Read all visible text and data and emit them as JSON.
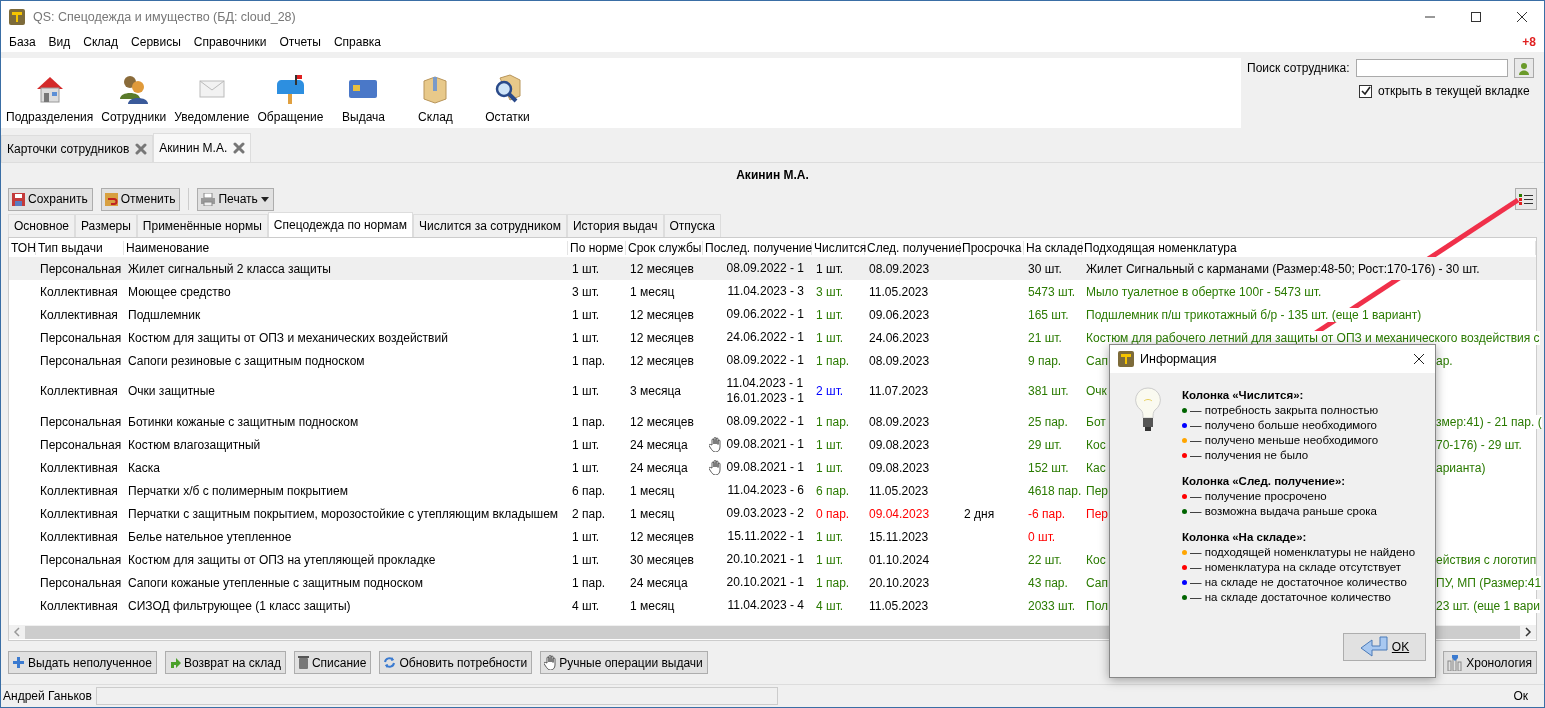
{
  "window": {
    "title": "QS: Спецодежда и имущество (БД: cloud_28)"
  },
  "menu": [
    "База",
    "Вид",
    "Склад",
    "Сервисы",
    "Справочники",
    "Отчеты",
    "Справка"
  ],
  "notification_count": "+8",
  "toolbar": [
    "Подразделения",
    "Сотрудники",
    "Уведомление",
    "Обращение",
    "Выдача",
    "Склад",
    "Остатки"
  ],
  "employee_search": {
    "label": "Поиск сотрудника:",
    "open_in_current_tab": {
      "label": "открыть в текущей вкладке",
      "checked": true
    }
  },
  "document_tabs": [
    {
      "label": "Карточки сотрудников",
      "selected": false
    },
    {
      "label": "Акинин М.А.",
      "selected": true
    }
  ],
  "heading": "Акинин М.А.",
  "actions": [
    {
      "label": "Сохранить",
      "kind": "save"
    },
    {
      "label": "Отменить",
      "kind": "cancel"
    },
    {
      "label": "Печать",
      "kind": "print"
    }
  ],
  "tabs": [
    {
      "label": "Основное",
      "selected": false
    },
    {
      "label": "Размеры",
      "selected": false
    },
    {
      "label": "Применённые нормы",
      "selected": false
    },
    {
      "label": "Спецодежда по нормам",
      "selected": true
    },
    {
      "label": "Числится за сотрудником",
      "selected": false
    },
    {
      "label": "История выдач",
      "selected": false
    },
    {
      "label": "Отпуска",
      "selected": false
    }
  ],
  "table": {
    "columns": [
      "ТОН",
      "Тип выдачи",
      "Наименование",
      "По норме",
      "Срок службы",
      "Послед. получение",
      "Числится",
      "След. получение",
      "Просрочка",
      "На складе",
      "Подходящая номенклатура"
    ],
    "rows": [
      {
        "selected": true,
        "type": "Персональная",
        "name": "Жилет сигнальный 2 класса защиты",
        "norm": "1 шт.",
        "term": "12 месяцев",
        "last": [
          "08.09.2022 - 1"
        ],
        "manual": false,
        "issued": {
          "text": "1 шт.",
          "color": "#000000"
        },
        "next": {
          "text": "08.09.2023",
          "overdue": false
        },
        "stock": {
          "text": "30 шт.",
          "color": "#000000"
        },
        "match": "Жилет Сигнальный с карманами (Размер:48-50; Рост:170-176) - 30 шт."
      },
      {
        "selected": false,
        "type": "Коллективная",
        "name": "Моющее средство",
        "norm": "3 шт.",
        "term": "1 месяц",
        "last": [
          "11.04.2023 - 3"
        ],
        "manual": false,
        "issued": {
          "text": "3 шт.",
          "color": "#2a7a00"
        },
        "next": {
          "text": "11.05.2023",
          "overdue": false
        },
        "stock": {
          "text": "5473 шт.",
          "color": "#2a7a00"
        },
        "match": "Мыло туалетное в обертке 100г - 5473 шт."
      },
      {
        "selected": false,
        "type": "Коллективная",
        "name": "Подшлемник",
        "norm": "1 шт.",
        "term": "12 месяцев",
        "last": [
          "09.06.2022 - 1"
        ],
        "manual": false,
        "issued": {
          "text": "1 шт.",
          "color": "#2a7a00"
        },
        "next": {
          "text": "09.06.2023",
          "overdue": false
        },
        "stock": {
          "text": "165 шт.",
          "color": "#2a7a00"
        },
        "match": "Подшлемник  п/ш трикотажный б/р - 135 шт. (еще 1 вариант)"
      },
      {
        "selected": false,
        "type": "Персональная",
        "name": "Костюм для защиты от ОПЗ и механических воздействий",
        "norm": "1 шт.",
        "term": "12 месяцев",
        "last": [
          "24.06.2022 - 1"
        ],
        "manual": false,
        "issued": {
          "text": "1 шт.",
          "color": "#2a7a00"
        },
        "next": {
          "text": "24.06.2023",
          "overdue": false
        },
        "stock": {
          "text": "21 шт.",
          "color": "#2a7a00"
        },
        "match": "Костюм для рабочего летний для защиты от ОПЗ и механического воздействия с"
      },
      {
        "selected": false,
        "type": "Персональная",
        "name": "Сапоги резиновые с защитным подноском",
        "norm": "1 пар.",
        "term": "12 месяцев",
        "last": [
          "08.09.2022 - 1"
        ],
        "manual": false,
        "issued": {
          "text": "1 пар.",
          "color": "#2a7a00"
        },
        "next": {
          "text": "08.09.2023",
          "overdue": false
        },
        "stock": {
          "text": "9 пар.",
          "color": "#2a7a00"
        },
        "match": "Сап",
        "match_tail": "ар."
      },
      {
        "selected": false,
        "type": "Коллективная",
        "name": "Очки защитные",
        "norm": "1 шт.",
        "term": "3 месяца",
        "last": [
          "11.04.2023 - 1",
          "16.01.2023 - 1"
        ],
        "manual": false,
        "issued": {
          "text": "2 шт.",
          "color": "#0000ff"
        },
        "next": {
          "text": "11.07.2023",
          "overdue": false
        },
        "stock": {
          "text": "381 шт.",
          "color": "#2a7a00"
        },
        "match": "Очк"
      },
      {
        "selected": false,
        "type": "Персональная",
        "name": "Ботинки кожаные с защитным подноском",
        "norm": "1 пар.",
        "term": "12 месяцев",
        "last": [
          "08.09.2022 - 1"
        ],
        "manual": false,
        "issued": {
          "text": "1 пар.",
          "color": "#2a7a00"
        },
        "next": {
          "text": "08.09.2023",
          "overdue": false
        },
        "stock": {
          "text": "25 пар.",
          "color": "#2a7a00"
        },
        "match": "Бот",
        "match_tail": "змер:41) - 21 пар. ("
      },
      {
        "selected": false,
        "type": "Персональная",
        "name": "Костюм влагозащитный",
        "norm": "1 шт.",
        "term": "24 месяца",
        "last": [
          "09.08.2021 - 1"
        ],
        "manual": true,
        "issued": {
          "text": "1 шт.",
          "color": "#2a7a00"
        },
        "next": {
          "text": "09.08.2023",
          "overdue": false
        },
        "stock": {
          "text": "29 шт.",
          "color": "#2a7a00"
        },
        "match": "Кос",
        "match_tail": "70-176) - 29 шт."
      },
      {
        "selected": false,
        "type": "Коллективная",
        "name": "Каска",
        "norm": "1 шт.",
        "term": "24 месяца",
        "last": [
          "09.08.2021 - 1"
        ],
        "manual": true,
        "issued": {
          "text": "1 шт.",
          "color": "#2a7a00"
        },
        "next": {
          "text": "09.08.2023",
          "overdue": false
        },
        "stock": {
          "text": "152 шт.",
          "color": "#2a7a00"
        },
        "match": "Кас",
        "match_tail": "арианта)"
      },
      {
        "selected": false,
        "type": "Коллективная",
        "name": "Перчатки х/б с полимерным покрытием",
        "norm": "6 пар.",
        "term": "1 месяц",
        "last": [
          "11.04.2023 - 6"
        ],
        "manual": false,
        "issued": {
          "text": "6 пар.",
          "color": "#2a7a00"
        },
        "next": {
          "text": "11.05.2023",
          "overdue": false
        },
        "stock": {
          "text": "4618 пар.",
          "color": "#2a7a00"
        },
        "match": "Пер"
      },
      {
        "selected": false,
        "type": "Коллективная",
        "name": "Перчатки с защитным покрытием, морозостойкие с утепляющим вкладышем",
        "norm": "2 пар.",
        "term": "1 месяц",
        "last": [
          "09.03.2023 - 2"
        ],
        "manual": false,
        "issued": {
          "text": "0 пар.",
          "color": "#ff0000"
        },
        "next": {
          "text": "09.04.2023",
          "overdue": true
        },
        "overdue": "2 дня",
        "stock": {
          "text": "-6 пар.",
          "color": "#ff0000"
        },
        "match": "Пер"
      },
      {
        "selected": false,
        "type": "Коллективная",
        "name": "Белье нательное утепленное",
        "norm": "1 шт.",
        "term": "12 месяцев",
        "last": [
          "15.11.2022 - 1"
        ],
        "manual": false,
        "issued": {
          "text": "1 шт.",
          "color": "#2a7a00"
        },
        "next": {
          "text": "15.11.2023",
          "overdue": false
        },
        "stock": {
          "text": "0 шт.",
          "color": "#ff0000"
        }
      },
      {
        "selected": false,
        "type": "Персональная",
        "name": "Костюм для защиты от ОПЗ  на утепляющей прокладке",
        "norm": "1 шт.",
        "term": "30 месяцев",
        "last": [
          "20.10.2021 - 1"
        ],
        "manual": false,
        "issued": {
          "text": "1 шт.",
          "color": "#2a7a00"
        },
        "next": {
          "text": "01.10.2024",
          "overdue": false
        },
        "stock": {
          "text": "22 шт.",
          "color": "#2a7a00"
        },
        "match": "Кос",
        "match_tail": "ействия с логотип"
      },
      {
        "selected": false,
        "type": "Персональная",
        "name": "Сапоги кожаные утепленные с защитным подноском",
        "norm": "1 пар.",
        "term": "24 месяца",
        "last": [
          "20.10.2021 - 1"
        ],
        "manual": false,
        "issued": {
          "text": "1 пар.",
          "color": "#2a7a00"
        },
        "next": {
          "text": "20.10.2023",
          "overdue": false
        },
        "stock": {
          "text": "43 пар.",
          "color": "#2a7a00"
        },
        "match": "Сап",
        "match_tail": "ПУ, МП (Размер:41"
      },
      {
        "selected": false,
        "type": "Коллективная",
        "name": "СИЗОД фильтрующее (1 класс защиты)",
        "norm": "4 шт.",
        "term": "1 месяц",
        "last": [
          "11.04.2023 - 4"
        ],
        "manual": false,
        "issued": {
          "text": "4 шт.",
          "color": "#2a7a00"
        },
        "next": {
          "text": "11.05.2023",
          "overdue": false
        },
        "stock": {
          "text": "2033 шт.",
          "color": "#2a7a00"
        },
        "match": "Пол",
        "match_tail": "23 шт. (еще 1 вари"
      }
    ]
  },
  "bottom_actions": [
    {
      "label": "Выдать неполученное",
      "kind": "issue"
    },
    {
      "label": "Возврат на склад",
      "kind": "return"
    },
    {
      "label": "Списание",
      "kind": "writeoff"
    },
    {
      "label": "Обновить потребности",
      "kind": "refresh"
    },
    {
      "label": "Ручные операции выдачи",
      "kind": "manual"
    }
  ],
  "history_button": "Хронология",
  "status_bar": {
    "user": "Андрей Ганьков",
    "state": "Ок"
  },
  "dialog": {
    "title": "Информация",
    "sections": [
      {
        "title": "Колонка «Числится»:",
        "items": [
          {
            "color": "#006400",
            "text": "— потребность закрыта полностью"
          },
          {
            "color": "#0000ff",
            "text": "— получено больше необходимого"
          },
          {
            "color": "#ffa500",
            "text": "— получено меньше необходимого"
          },
          {
            "color": "#ff0000",
            "text": "— получения не было"
          }
        ]
      },
      {
        "title": "Колонка «След. получение»:",
        "items": [
          {
            "color": "#ff0000",
            "text": "— получение просрочено"
          },
          {
            "color": "#006400",
            "text": "— возможна выдача раньше срока"
          }
        ]
      },
      {
        "title": "Колонка «На складе»:",
        "items": [
          {
            "color": "#ffa500",
            "text": "— подходящей номенклатуры не найдено"
          },
          {
            "color": "#ff0000",
            "text": "— номенклатура на складе отсутствует"
          },
          {
            "color": "#0000ff",
            "text": "— на складе не достаточное количество"
          },
          {
            "color": "#006400",
            "text": "— на складе достаточное количество"
          }
        ]
      }
    ],
    "ok_button": "OK"
  }
}
